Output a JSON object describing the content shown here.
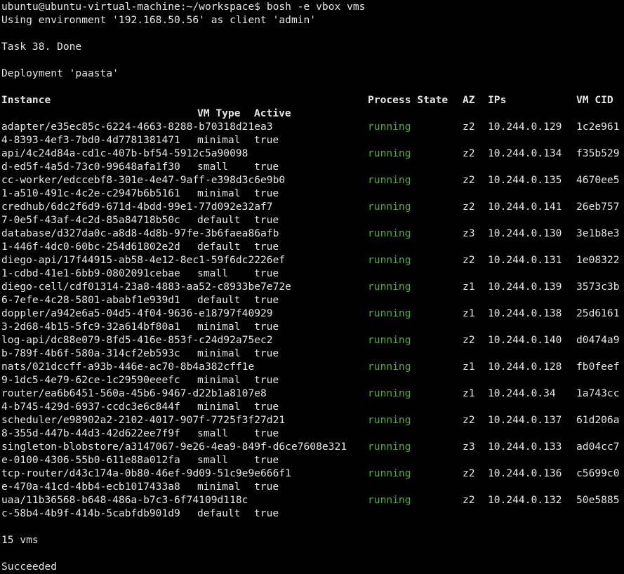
{
  "prompt": {
    "user_host": "ubuntu@ubuntu-virtual-machine:~/workspace$",
    "command": "bosh -e vbox vms"
  },
  "env_line": "Using environment '192.168.50.56' as client 'admin'",
  "task_line": "Task 38. Done",
  "deployment_line": "Deployment 'paasta'",
  "headers": {
    "instance": "Instance",
    "process_state": "Process State",
    "az": "AZ",
    "ips": "IPs",
    "vm_cid": "VM CID",
    "vm_type": "VM Type",
    "active": "Active"
  },
  "rows": [
    {
      "inst1": "adapter/e35ec85c-6224-4663-8288-b70318d21ea3",
      "state": "running",
      "az": "z2",
      "ip": "10.244.0.129",
      "cid": "1c2e961",
      "inst2": "4-8393-4ef3-7bd0-4d7781381471",
      "vm_type": "minimal",
      "active": "true"
    },
    {
      "inst1": "api/4c24d84a-cd1c-407b-bf54-5912c5a90098",
      "state": "running",
      "az": "z2",
      "ip": "10.244.0.134",
      "cid": "f35b529",
      "inst2": "d-ed5f-4a5d-73c0-99648afa1f30",
      "vm_type": "small",
      "active": "true"
    },
    {
      "inst1": "cc-worker/edccebf8-301e-4e47-9aff-e398d3c6e9b0",
      "state": "running",
      "az": "z2",
      "ip": "10.244.0.135",
      "cid": "4670ee5",
      "inst2": "1-a510-491c-4c2e-c2947b6b5161",
      "vm_type": "minimal",
      "active": "true"
    },
    {
      "inst1": "credhub/6dc2f6d9-671d-4bdd-99e1-77d092e32af7",
      "state": "running",
      "az": "z2",
      "ip": "10.244.0.141",
      "cid": "26eb757",
      "inst2": "7-0e5f-43af-4c2d-85a84718b50c",
      "vm_type": "default",
      "active": "true"
    },
    {
      "inst1": "database/d327da0c-a8d8-4d8b-97fe-3b6faea86afb",
      "state": "running",
      "az": "z3",
      "ip": "10.244.0.130",
      "cid": "3e1b8e3",
      "inst2": "1-446f-4dc0-60bc-254d61802e2d",
      "vm_type": "default",
      "active": "true"
    },
    {
      "inst1": "diego-api/17f44915-ab58-4e12-8ec1-59f6dc2226ef",
      "state": "running",
      "az": "z2",
      "ip": "10.244.0.131",
      "cid": "1e08322",
      "inst2": "1-cdbd-41e1-6bb9-0802091cebae",
      "vm_type": "small",
      "active": "true"
    },
    {
      "inst1": "diego-cell/cdf01314-23a8-4883-aa52-c8933be7e72e",
      "state": "running",
      "az": "z1",
      "ip": "10.244.0.139",
      "cid": "3573c3b",
      "inst2": "6-7efe-4c28-5801-ababf1e939d1",
      "vm_type": "default",
      "active": "true"
    },
    {
      "inst1": "doppler/a942e6a5-04d5-4f04-9636-e18797f40929",
      "state": "running",
      "az": "z1",
      "ip": "10.244.0.138",
      "cid": "25d6161",
      "inst2": "3-2d68-4b15-5fc9-32a614bf80a1",
      "vm_type": "minimal",
      "active": "true"
    },
    {
      "inst1": "log-api/dc88e079-8fd5-416e-853f-c24d92a75ec2",
      "state": "running",
      "az": "z2",
      "ip": "10.244.0.140",
      "cid": "d0474a9",
      "inst2": "b-789f-4b6f-580a-314cf2eb593c",
      "vm_type": "minimal",
      "active": "true"
    },
    {
      "inst1": "nats/021dccff-a93b-446e-ac70-8b4a382cff1e",
      "state": "running",
      "az": "z1",
      "ip": "10.244.0.128",
      "cid": "fb0feef",
      "inst2": "9-1dc5-4e79-62ce-1c29590eeefc",
      "vm_type": "minimal",
      "active": "true"
    },
    {
      "inst1": "router/ea6b6451-560a-45b6-9467-d22b1a8107e8",
      "state": "running",
      "az": "z1",
      "ip": "10.244.0.34",
      "cid": "1a743cc",
      "inst2": "4-b745-429d-6937-ccdc3e6c844f",
      "vm_type": "minimal",
      "active": "true"
    },
    {
      "inst1": "scheduler/e98902a2-2102-4017-907f-7725f3f27d21",
      "state": "running",
      "az": "z2",
      "ip": "10.244.0.137",
      "cid": "61d206a",
      "inst2": "8-355d-447b-44d3-42d622ee7f9f",
      "vm_type": "small",
      "active": "true"
    },
    {
      "inst1": "singleton-blobstore/a3147067-9e26-4ea9-849f-d6ce7608e321",
      "state": "running",
      "az": "z3",
      "ip": "10.244.0.133",
      "cid": "ad04cc7",
      "inst2": "e-0100-4306-55b0-611e88a012fa",
      "vm_type": "small",
      "active": "true"
    },
    {
      "inst1": "tcp-router/d43c174a-0b80-46ef-9d09-51c9e9e666f1",
      "state": "running",
      "az": "z2",
      "ip": "10.244.0.136",
      "cid": "c5699c0",
      "inst2": "e-470a-41cd-4bb4-ecb1017433a8",
      "vm_type": "minimal",
      "active": "true"
    },
    {
      "inst1": "uaa/11b36568-b648-486a-b7c3-6f74109d118c",
      "state": "running",
      "az": "z2",
      "ip": "10.244.0.132",
      "cid": "50e5885",
      "inst2": "c-58b4-4b9f-414b-5cabfdb901d9",
      "vm_type": "default",
      "active": "true"
    }
  ],
  "count_line": "15 vms",
  "result_line": "Succeeded",
  "colors": {
    "background": "#000000",
    "text": "#e5e5e5",
    "running": "#4caf2a"
  }
}
